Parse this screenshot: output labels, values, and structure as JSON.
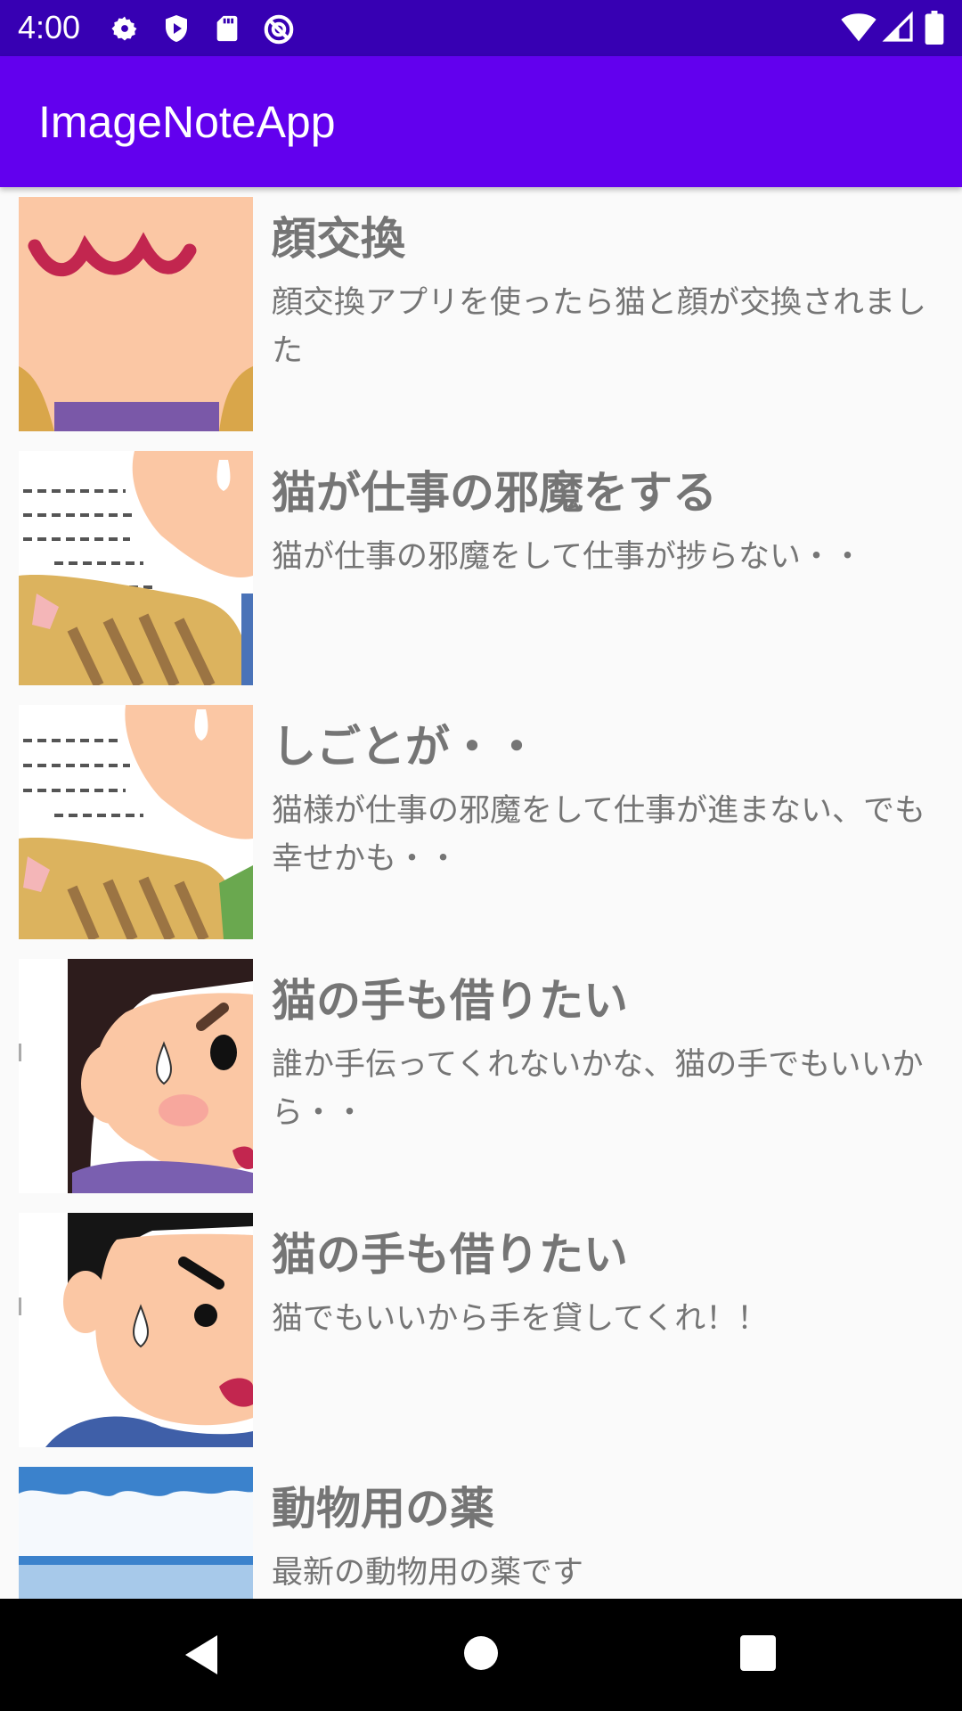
{
  "status_bar": {
    "time": "4:00",
    "left_icons": [
      "gear-icon",
      "shield-play-icon",
      "sd-card-icon",
      "no-disturb-icon"
    ],
    "right_icons": [
      "wifi-icon",
      "cell-signal-icon",
      "battery-icon"
    ]
  },
  "app_bar": {
    "title": "ImageNoteApp",
    "color": "#6200ee",
    "status_color": "#3700b3"
  },
  "notes": [
    {
      "title": "顔交換",
      "description": "顔交換アプリを使ったら猫と顔が交換されました",
      "image": "face-mouth-image"
    },
    {
      "title": "猫が仕事の邪魔をする",
      "description": "猫が仕事の邪魔をして仕事が捗らない・・",
      "image": "cat-paper-image"
    },
    {
      "title": "しごとが・・",
      "description": "猫様が仕事の邪魔をして仕事が進まない、でも幸せかも・・",
      "image": "cat-paper-image-2"
    },
    {
      "title": "猫の手も借りたい",
      "description": "誰か手伝ってくれないかな、猫の手でもいいから・・",
      "image": "woman-sweat-image"
    },
    {
      "title": "猫の手も借りたい",
      "description": "猫でもいいから手を貸してくれ！！",
      "image": "man-sweat-image"
    },
    {
      "title": "動物用の薬",
      "description": "最新の動物用の薬です",
      "image": "medicine-label-image"
    }
  ],
  "nav_bar": {
    "buttons": [
      "back-button",
      "home-button",
      "recents-button"
    ]
  }
}
